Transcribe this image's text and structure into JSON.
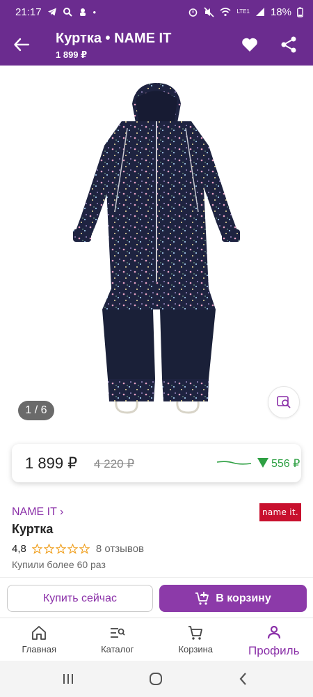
{
  "status_bar": {
    "time": "21:17",
    "battery": "18%",
    "network": "LTE1"
  },
  "header": {
    "title": "Куртка • NAME IT",
    "subtitle": "1 899 ₽"
  },
  "gallery": {
    "counter": "1 / 6"
  },
  "price_card": {
    "price": "1 899 ₽",
    "old_price": "4 220 ₽",
    "drop": "556 ₽"
  },
  "product": {
    "brand": "NAME IT ›",
    "brand_logo_text": "name it.",
    "name": "Куртка",
    "rating": "4,8",
    "stars": 5,
    "reviews": "8 отзывов",
    "bought": "Купили более 60 раз"
  },
  "actions": {
    "buy_now": "Купить сейчас",
    "to_cart": "В корзину"
  },
  "bottom_nav": {
    "home": "Главная",
    "catalog": "Каталог",
    "cart": "Корзина",
    "profile": "Профиль"
  },
  "colors": {
    "brand_purple": "#6b2c8f",
    "accent_purple": "#8a2fa8",
    "price_drop_green": "#2ea043",
    "logo_red": "#c8102e"
  }
}
